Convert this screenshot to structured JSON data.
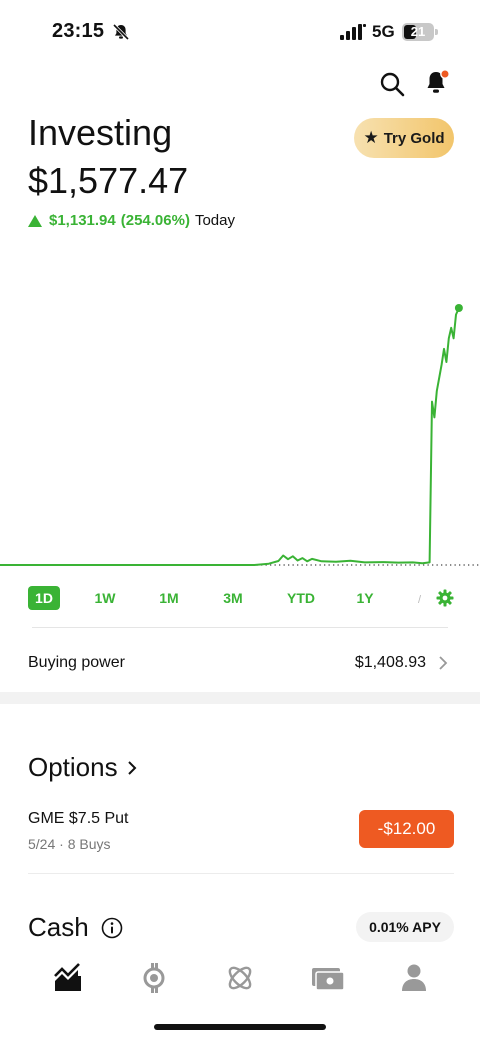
{
  "status_bar": {
    "time": "23:15",
    "network": "5G",
    "battery": "21"
  },
  "header": {
    "title": "Investing",
    "portfolio_value": "$1,577.47",
    "gold_label": "Try Gold"
  },
  "change": {
    "amount": "$1,131.94",
    "percent": "(254.06%)",
    "period": "Today",
    "direction": "up"
  },
  "colors": {
    "accent": "#3ab335",
    "gold": "#f2c56b",
    "loss": "#ee5a22"
  },
  "chart_data": {
    "type": "line",
    "range": "1D",
    "baseline": "dotted previous close",
    "points": [
      [
        0,
        0
      ],
      [
        0.53,
        0
      ],
      [
        0.56,
        0.5
      ],
      [
        0.58,
        1.5
      ],
      [
        0.59,
        3.6
      ],
      [
        0.6,
        2.2
      ],
      [
        0.61,
        3.3
      ],
      [
        0.62,
        1.7
      ],
      [
        0.63,
        2.6
      ],
      [
        0.64,
        1.4
      ],
      [
        0.65,
        2.3
      ],
      [
        0.67,
        1.4
      ],
      [
        0.7,
        1.2
      ],
      [
        0.73,
        1.6
      ],
      [
        0.76,
        1.0
      ],
      [
        0.8,
        1.1
      ],
      [
        0.83,
        0.9
      ],
      [
        0.86,
        1.0
      ],
      [
        0.88,
        0.7
      ],
      [
        0.895,
        1.0
      ],
      [
        0.9,
        62
      ],
      [
        0.905,
        56
      ],
      [
        0.91,
        66
      ],
      [
        0.92,
        76
      ],
      [
        0.925,
        82
      ],
      [
        0.93,
        77
      ],
      [
        0.935,
        86
      ],
      [
        0.94,
        90
      ],
      [
        0.945,
        86
      ],
      [
        0.95,
        95
      ],
      [
        0.956,
        97.5
      ]
    ]
  },
  "ranges": {
    "labels": [
      "1D",
      "1W",
      "1M",
      "3M",
      "YTD",
      "1Y"
    ],
    "active": "1D"
  },
  "buying_power": {
    "label": "Buying power",
    "value": "$1,408.93"
  },
  "options": {
    "heading": "Options",
    "position": {
      "name": "GME $7.5 Put",
      "meta": "5/24 · 8 Buys",
      "pl": "-$12.00"
    }
  },
  "cash": {
    "heading": "Cash",
    "apy": "0.01% APY"
  },
  "tabs": [
    "chart-icon",
    "crypto-icon",
    "atom-icon",
    "cash-card-icon",
    "account-icon"
  ]
}
